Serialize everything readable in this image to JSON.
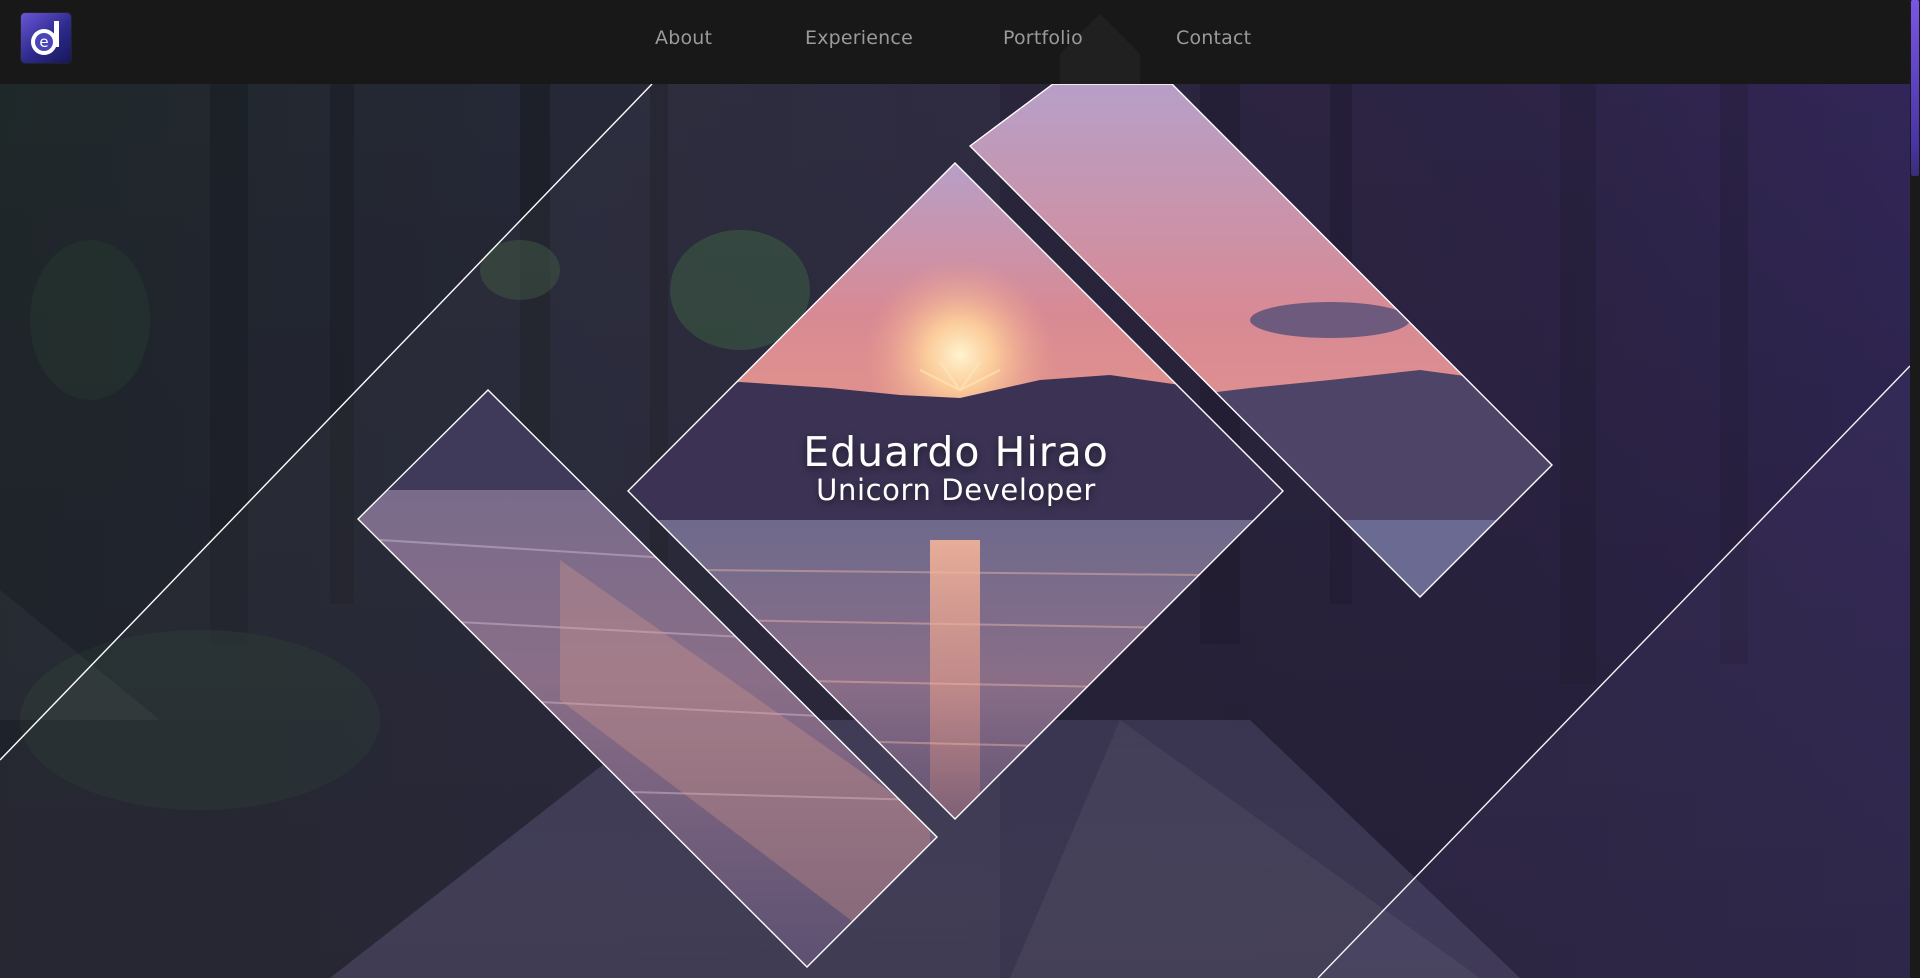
{
  "nav": {
    "logo_alt": "e",
    "links": [
      "About",
      "Experience",
      "Portfolio",
      "Contact"
    ]
  },
  "hero": {
    "name": "Eduardo Hirao",
    "title": "Unicorn Developer"
  },
  "colors": {
    "accent": "#6a56d8",
    "nav_background": "#181818",
    "nav_text": "#9a9a9a",
    "overlay": "#2a2044"
  },
  "icons": {
    "logo": "logo-icon",
    "peak": "triangle-decoration-icon"
  }
}
